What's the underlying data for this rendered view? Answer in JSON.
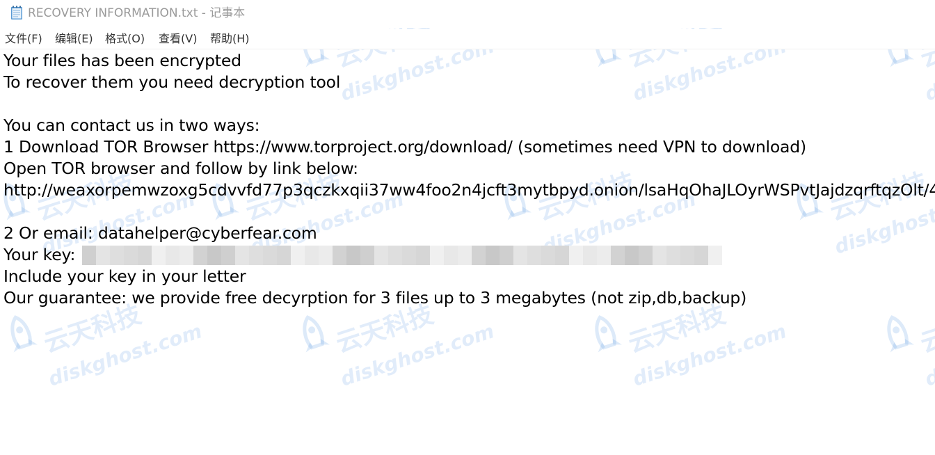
{
  "window": {
    "title": "RECOVERY INFORMATION.txt - 记事本",
    "icon": "notepad-icon"
  },
  "menu": {
    "items": [
      {
        "label": "文件(F)"
      },
      {
        "label": "编辑(E)"
      },
      {
        "label": "格式(O)"
      },
      {
        "label": "查看(V)"
      },
      {
        "label": "帮助(H)"
      }
    ]
  },
  "document": {
    "lines": [
      "Your files has been encrypted",
      "To recover them you need decryption tool",
      "",
      "You can contact us in two ways:",
      "1 Download TOR Browser https://www.torproject.org/download/ (sometimes need VPN to download)",
      "Open TOR browser and follow by link below:",
      "http://weaxorpemwzoxg5cdvvfd77p3qczkxqii37ww4foo2n4jcft3mytbpyd.onion/lsaHqOhaJLOyrWSPvtJajdzqrftqzOlt/4",
      "",
      "2 Or email: datahelper@cyberfear.com",
      "Your key:",
      "Include your key in your letter",
      "Our guarantee: we provide free decyrption for 3 files up to 3 megabytes (not zip,db,backup)"
    ]
  },
  "watermark": {
    "cn": "云天科技",
    "en": "diskghost.com"
  },
  "colors": {
    "title_text": "#9a9a9a",
    "menu_text": "#333333",
    "body_text": "#000000",
    "watermark": "#78aae6"
  }
}
